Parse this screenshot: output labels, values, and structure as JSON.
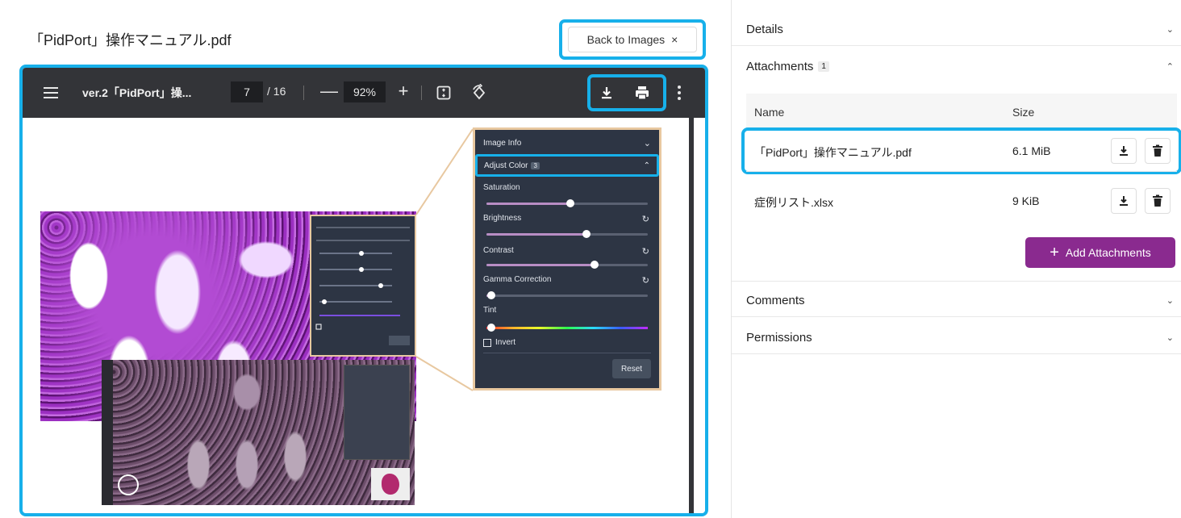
{
  "document": {
    "title": "「PidPort」操作マニュアル.pdf",
    "back_button": "Back to Images",
    "back_close": "×"
  },
  "viewer": {
    "doc_name": "ver.2「PidPort」操...",
    "page_current": "7",
    "page_total": "/ 16",
    "zoom_minus": "—",
    "zoom": "92%",
    "zoom_plus": "+"
  },
  "screenshot_panel": {
    "image_info": "Image Info",
    "adjust_color": "Adjust Color",
    "adjust_badge": "3",
    "saturation": "Saturation",
    "saturation_value": 0.52,
    "brightness": "Brightness",
    "brightness_value": 0.62,
    "contrast": "Contrast",
    "contrast_value": 0.67,
    "gamma": "Gamma Correction",
    "gamma_value": 0.03,
    "tint": "Tint",
    "tint_value": 0.03,
    "invert": "Invert",
    "reset": "Reset"
  },
  "sidebar": {
    "details": "Details",
    "attachments": "Attachments",
    "attachments_count": "1",
    "table": {
      "col_name": "Name",
      "col_size": "Size",
      "rows": [
        {
          "name": "「PidPort」操作マニュアル.pdf",
          "size": "6.1 MiB"
        },
        {
          "name": "症例リスト.xlsx",
          "size": "9 KiB"
        }
      ]
    },
    "add_attachments": "Add Attachments",
    "add_icon": "+",
    "comments": "Comments",
    "permissions": "Permissions"
  },
  "colors": {
    "highlight": "#17b0ea",
    "accent": "#8a2a8f",
    "viewer_toolbar": "#333438"
  }
}
